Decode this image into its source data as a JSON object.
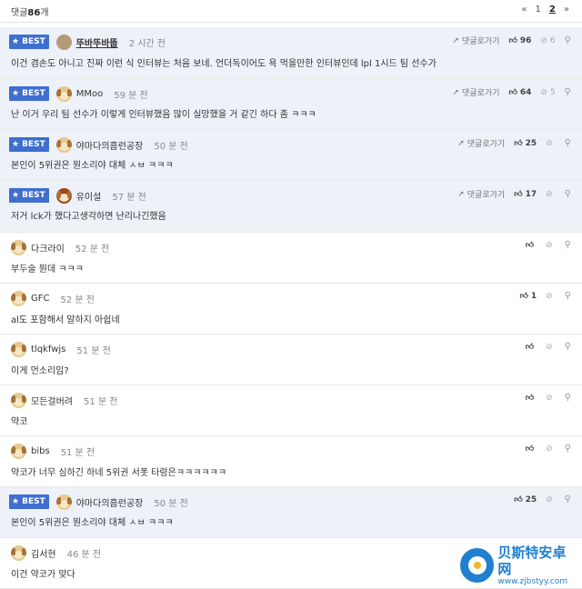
{
  "header": {
    "count_label": "댓글",
    "count": "86",
    "count_suffix": "개",
    "pager": {
      "prev": "«",
      "page1": "1",
      "page2": "2",
      "next": "»"
    }
  },
  "labels": {
    "best": "BEST",
    "reply": "댓글로가기"
  },
  "comments": [
    {
      "best": true,
      "nick": "뚜바뚜바뚭",
      "time": "2 시간 전",
      "text": "이건 겸손도 아니고 진짜 이런 식 인터뷰는 처음 보네. 언더독이어도 욕 먹을만한 인터뷰인데 lpl 1시드 팀 선수가",
      "up": "96",
      "down": "6"
    },
    {
      "best": true,
      "nick": "MMoo",
      "time": "59 분 전",
      "text": "난 이거 우리 팀 선수가 이렇게 인터뷰했음 많이 실망했을 거 같긴 하다 좀 ㅋㅋㅋ",
      "up": "64",
      "down": "5"
    },
    {
      "best": true,
      "nick": "야마다의흠런공장",
      "time": "50 분 전",
      "text": "본인이 5위권은 뭔소리야 대체 ㅅㅂ ㅋㅋㅋ",
      "up": "25",
      "down": ""
    },
    {
      "best": true,
      "nick": "유이설",
      "time": "57 분 전",
      "text": "저거 lck가 했다고생각하면 난리나긴했음",
      "up": "17",
      "down": ""
    },
    {
      "best": false,
      "nick": "다크라이",
      "time": "52 분 전",
      "text": "부두술 뭔데 ㅋㅋㅋ",
      "up": "",
      "down": ""
    },
    {
      "best": false,
      "nick": "GFC",
      "time": "52 분 전",
      "text": "al도 포함해서 말하지 아쉽네",
      "up": "1",
      "down": ""
    },
    {
      "best": false,
      "nick": "tlqkfwjs",
      "time": "51 분 전",
      "text": "이게 먼소리임?",
      "up": "",
      "down": ""
    },
    {
      "best": false,
      "nick": "모든걸버려",
      "time": "51 분 전",
      "text": "약코",
      "up": "",
      "down": ""
    },
    {
      "best": false,
      "nick": "bibs",
      "time": "51 분 전",
      "text": "약코가 너무 심하긴 하네 5위권 서폿 타령은ㅋㅋㅋㅋㅋㅋ",
      "up": "",
      "down": ""
    },
    {
      "best": true,
      "nick": "야마다의흠런공장",
      "time": "50 분 전",
      "text": "본인이 5위권은 뭔소리야 대체 ㅅㅂ ㅋㅋㅋ",
      "up": "25",
      "down": ""
    },
    {
      "best": false,
      "nick": "김서현",
      "time": "46 분 전",
      "text": "이건 약코가 맞다",
      "up": "",
      "down": ""
    }
  ],
  "watermark": {
    "title": "贝斯特安卓网",
    "url": "www.zjbstyy.com"
  },
  "colors": {
    "best_badge": "#3e6fd0",
    "best_row": "#eef1f8"
  }
}
